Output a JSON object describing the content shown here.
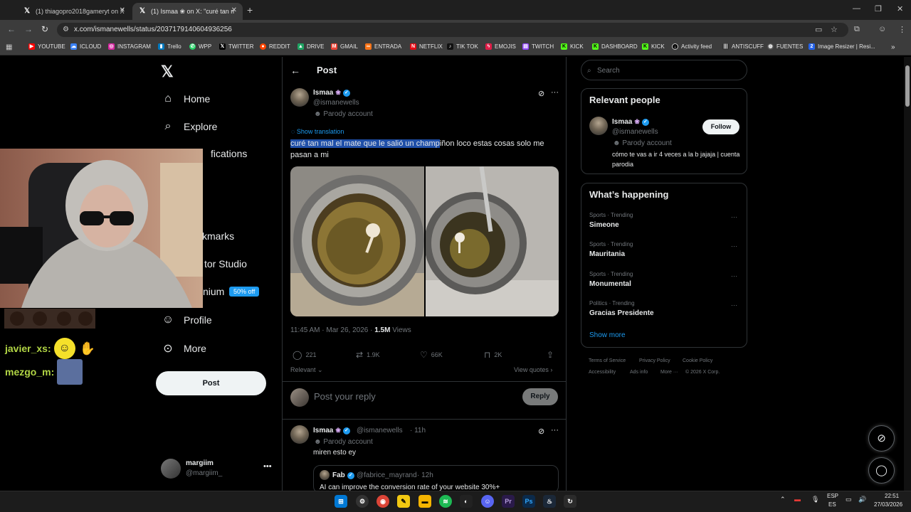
{
  "browser": {
    "tabs": [
      {
        "label": "(1) thiagopro2018gameryt on X",
        "active": false
      },
      {
        "label": "(1) Ismaa ❀ on X: \"curé tan m…",
        "active": true
      }
    ],
    "url": "x.com/ismanewells/status/2037179140604936256",
    "bookmarks": [
      "YOUTUBE",
      "ICLOUD",
      "INSTAGRAM",
      "Trello",
      "WPP",
      "TWITTER",
      "REDDIT",
      "DRIVE",
      "GMAIL",
      "ENTRADA",
      "NETFLIX",
      "TIK TOK",
      "EMOJIS",
      "TWITCH",
      "KICK",
      "DASHBOARD",
      "KICK",
      "Activity feed",
      "ANTISCUFF",
      "FUENTES",
      "Image Resizer | Resi..."
    ]
  },
  "sidebar": {
    "items": [
      {
        "label": "Home",
        "icon": "home-icon"
      },
      {
        "label": "Explore",
        "icon": "search-icon"
      },
      {
        "label": "fications",
        "icon": "bell-icon"
      },
      {
        "label": "kmarks",
        "icon": "bookmark-icon"
      },
      {
        "label": "tor Studio",
        "icon": "studio-icon"
      },
      {
        "label": "nium",
        "icon": "premium-icon"
      },
      {
        "label": "Profile",
        "icon": "person-icon"
      },
      {
        "label": "More",
        "icon": "more-circle-icon"
      }
    ],
    "premium_badge": "50% off",
    "post_button": "Post",
    "account": {
      "name": "margiim",
      "handle": "@margiim_"
    }
  },
  "post_page": {
    "heading": "Post",
    "tweet": {
      "name": "Ismaa",
      "handle": "@ismanewells",
      "parody": "Parody account",
      "show_translation": "Show translation",
      "text_selected": "curé tan mal el mate que le salió un champ",
      "text_rest": "iñon loco estas cosas solo me pasan a mi",
      "timestamp": "11:45 AM · Mar 26, 2026 · ",
      "views_count": "1.5M",
      "views_label": " Views",
      "replies": "221",
      "reposts": "1.9K",
      "likes": "66K",
      "bookmarks": "2K"
    },
    "sort": "Relevant",
    "view_quotes": "View quotes",
    "reply_placeholder": "Post your reply",
    "reply_button": "Reply",
    "reply": {
      "name": "Ismaa",
      "handle": "@ismanewells",
      "time": "· 11h",
      "parody": "Parody account",
      "text": "miren esto ey",
      "quote": {
        "name": "Fab",
        "handle": "@fabrice_mayrand",
        "time": "· 12h",
        "text": "AI can improve the conversion rate of your website 30%+"
      }
    }
  },
  "right": {
    "search_placeholder": "Search",
    "relevant_people": {
      "title": "Relevant people",
      "name": "Ismaa",
      "handle": "@ismanewells",
      "parody": "Parody account",
      "follow": "Follow",
      "bio": "cómo te vas a ir 4 veces a la b jajaja | cuenta parodia"
    },
    "happening": {
      "title": "What’s happening",
      "trends": [
        {
          "category": "Sports · Trending",
          "name": "Simeone"
        },
        {
          "category": "Sports · Trending",
          "name": "Mauritania"
        },
        {
          "category": "Sports · Trending",
          "name": "Monumental"
        },
        {
          "category": "Politics · Trending",
          "name": "Gracias Presidente"
        }
      ],
      "show_more": "Show more"
    },
    "footer": [
      "Terms of Service",
      "Privacy Policy",
      "Cookie Policy",
      "Accessibility",
      "Ads info",
      "More ···",
      "© 2026 X Corp."
    ]
  },
  "chat": [
    {
      "user": "javier_xs:"
    },
    {
      "user": "mezgo_m:"
    }
  ],
  "taskbar": {
    "lang_line1": "ESP",
    "lang_line2": "ES",
    "time": "22:51",
    "date": "27/03/2026"
  },
  "colors": {
    "accent": "#1d9bf0",
    "chat_user": "#b2d645"
  }
}
